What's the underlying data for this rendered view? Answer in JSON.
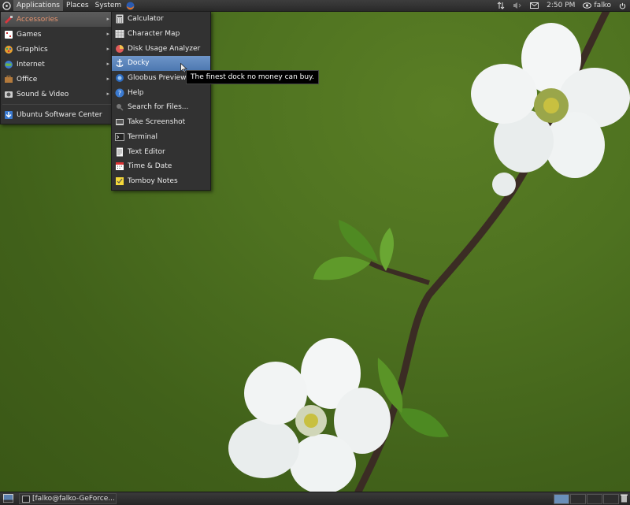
{
  "top_panel": {
    "menus": [
      "Applications",
      "Places",
      "System"
    ],
    "clock": "2:50 PM",
    "user": "falko"
  },
  "apps_menu": {
    "items": [
      {
        "label": "Accessories",
        "icon": "accessories-icon",
        "submenu": true
      },
      {
        "label": "Games",
        "icon": "games-icon",
        "submenu": true
      },
      {
        "label": "Graphics",
        "icon": "graphics-icon",
        "submenu": true
      },
      {
        "label": "Internet",
        "icon": "internet-icon",
        "submenu": true
      },
      {
        "label": "Office",
        "icon": "office-icon",
        "submenu": true
      },
      {
        "label": "Sound & Video",
        "icon": "sound-video-icon",
        "submenu": true
      }
    ],
    "software_center": "Ubuntu Software Center"
  },
  "accessories_menu": {
    "items": [
      {
        "label": "Calculator",
        "icon": "calculator-icon"
      },
      {
        "label": "Character Map",
        "icon": "character-map-icon"
      },
      {
        "label": "Disk Usage Analyzer",
        "icon": "disk-usage-icon"
      },
      {
        "label": "Docky",
        "icon": "docky-icon"
      },
      {
        "label": "Gloobus Preview",
        "icon": "gloobus-icon"
      },
      {
        "label": "Help",
        "icon": "help-icon"
      },
      {
        "label": "Search for Files...",
        "icon": "search-icon"
      },
      {
        "label": "Take Screenshot",
        "icon": "screenshot-icon"
      },
      {
        "label": "Terminal",
        "icon": "terminal-icon"
      },
      {
        "label": "Text Editor",
        "icon": "text-editor-icon"
      },
      {
        "label": "Time & Date",
        "icon": "calendar-icon"
      },
      {
        "label": "Tomboy Notes",
        "icon": "tomboy-icon"
      }
    ]
  },
  "tooltip": "The finest dock no money can buy.",
  "bottom_panel": {
    "task": "[falko@falko-GeForce..."
  },
  "colors": {
    "panel": "#2f2f2f",
    "menu_bg": "#323232",
    "highlight": "#5a83bb",
    "accent_text": "#e99570"
  }
}
